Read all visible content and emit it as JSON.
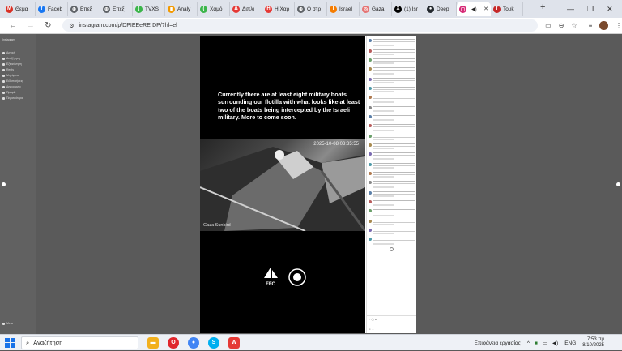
{
  "tabs": [
    {
      "label": "Θεμα",
      "icon": "gmail-icon",
      "color": "#d93025",
      "glyph": "M"
    },
    {
      "label": "Faceb",
      "icon": "facebook-icon",
      "color": "#1877f2",
      "glyph": "f"
    },
    {
      "label": "Επεξ",
      "icon": "globe-icon",
      "color": "#5f6368",
      "glyph": "⊕"
    },
    {
      "label": "Επεξ",
      "icon": "globe-icon",
      "color": "#5f6368",
      "glyph": "⊕"
    },
    {
      "label": "TVXS",
      "icon": "tvxs-icon",
      "color": "#3bb54a",
      "glyph": "("
    },
    {
      "label": "Analy",
      "icon": "analytics-icon",
      "color": "#f29900",
      "glyph": "▮"
    },
    {
      "label": "Χαμό",
      "icon": "tvxs-icon",
      "color": "#3bb54a",
      "glyph": "("
    },
    {
      "label": "Διπλι",
      "icon": "news-icon",
      "color": "#e53935",
      "glyph": "Δ"
    },
    {
      "label": "Η Χαρ",
      "icon": "news-icon",
      "color": "#e53935",
      "glyph": "Η"
    },
    {
      "label": "Ο στρ",
      "icon": "globe-icon",
      "color": "#5f6368",
      "glyph": "⊕"
    },
    {
      "label": "Israel",
      "icon": "news-icon",
      "color": "#f57c00",
      "glyph": "I"
    },
    {
      "label": "Gaza",
      "icon": "gaza-icon",
      "color": "#e57373",
      "glyph": "◎"
    },
    {
      "label": "(1) Isr",
      "icon": "x-icon",
      "color": "#000000",
      "glyph": "X"
    },
    {
      "label": "Deep",
      "icon": "github-icon",
      "color": "#24292e",
      "glyph": "●"
    },
    {
      "label": "",
      "icon": "instagram-icon",
      "color": "#d62976",
      "glyph": "◻",
      "active": true
    },
    {
      "label": "Toυk",
      "icon": "news-icon",
      "color": "#c62828",
      "glyph": "T"
    }
  ],
  "url": "instagram.com/p/DPIEEeRErDP/?hl=el",
  "post": {
    "caption": "Currently there are at least eight military boats surrounding our flotilla with what looks like at least two of the boats being intercepted by the Israeli military. More to come soon.",
    "video_timestamp": "2025-10-08 03:35:55",
    "video_label": "Gaza Sunbird",
    "logo_text": "FFC"
  },
  "sidebar_labels": [
    "Instagram",
    "Αρχική",
    "Αναζήτηση",
    "Εξερεύνηση",
    "Reels",
    "Μηνύματα",
    "Ειδοποιήσεις",
    "Δημιουργία",
    "Προφίλ",
    "Περισσότερα",
    "Meta"
  ],
  "taskbar": {
    "search_placeholder": "Αναζήτηση",
    "status_text": "Επιφάνεια εργασίας",
    "lang": "ENG",
    "time": "7:53 πμ",
    "date": "8/10/2025"
  }
}
